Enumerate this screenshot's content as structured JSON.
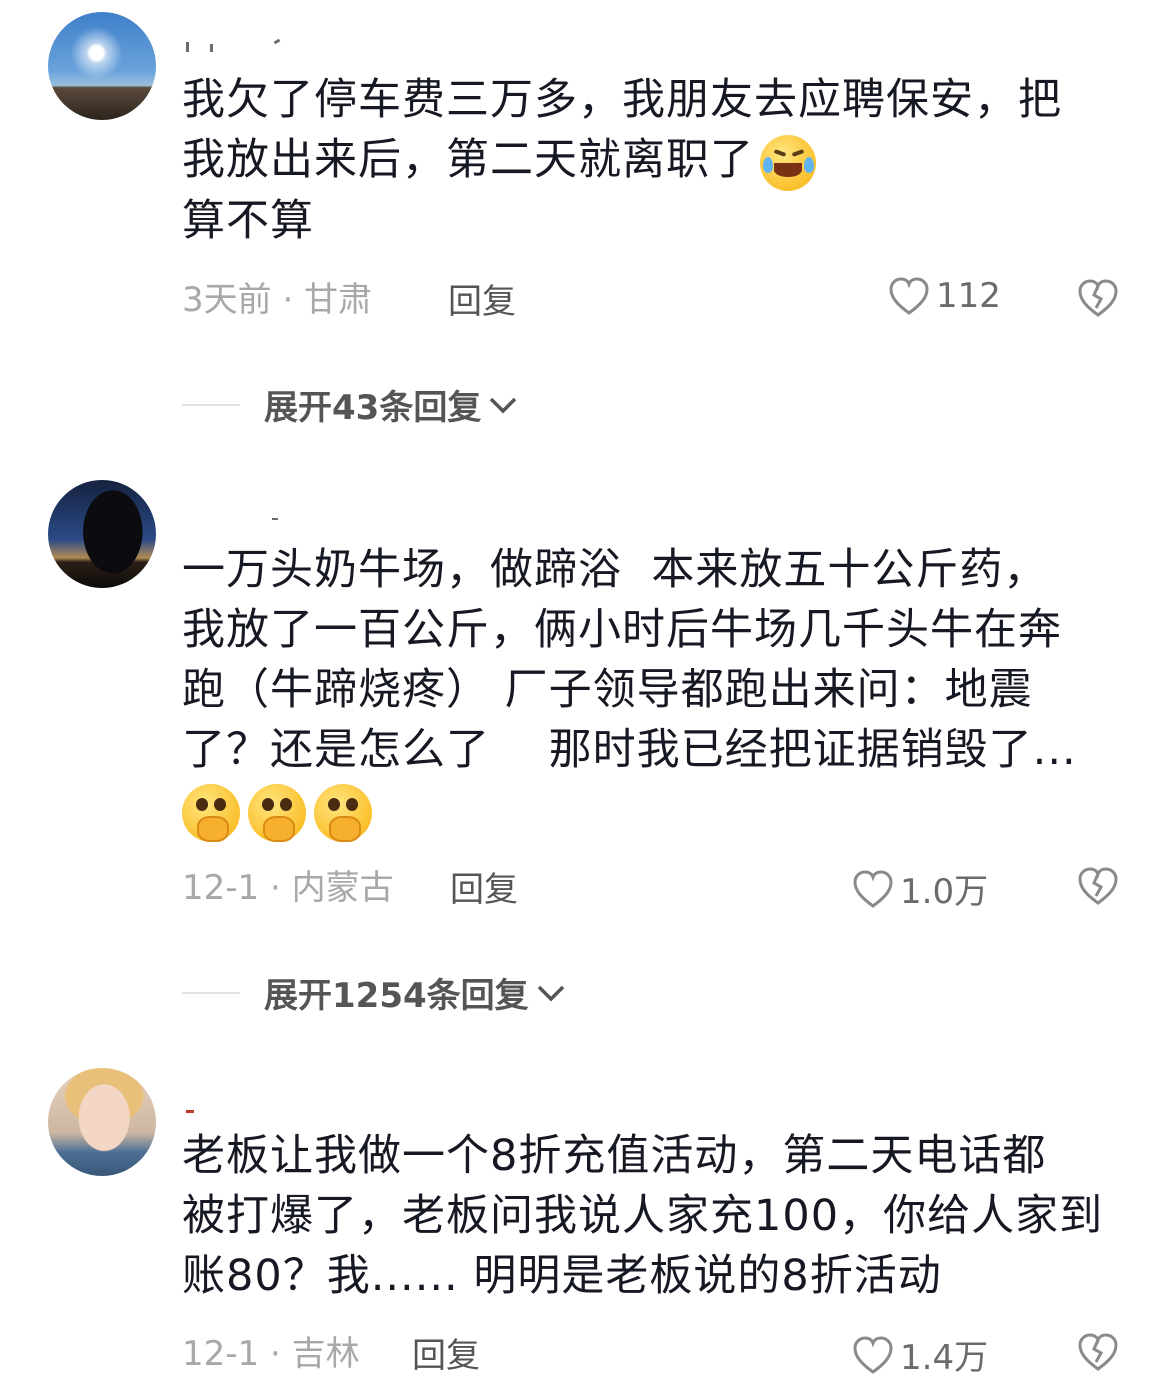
{
  "comments": [
    {
      "text_lines": [
        "我欠了停车费三万多，我朋友去应聘保安，把",
        "我放出来后，第二天就离职了",
        "算不算"
      ],
      "meta": "3天前 · 甘肃",
      "reply_label": "回复",
      "likes": "112",
      "expand_label": "展开43条回复"
    },
    {
      "text_lines": [
        "一万头奶牛场，做蹄浴  本来放五十公斤药，",
        "我放了一百公斤，俩小时后牛场几千头牛在奔",
        "跑（牛蹄烧疼） 厂子领导都跑出来问：地震",
        "了？还是怎么了    那时我已经把证据销毁了..."
      ],
      "meta": "12-1 · 内蒙古",
      "reply_label": "回复",
      "likes": "1.0万",
      "expand_label": "展开1254条回复"
    },
    {
      "text_lines": [
        "老板让我做一个8折充值活动，第二天电话都",
        "被打爆了，老板问我说人家充100，你给人家到",
        "账80？我...... 明明是老板说的8折活动"
      ],
      "meta": "12-1 · 吉林",
      "reply_label": "回复",
      "likes": "1.4万"
    }
  ],
  "icons": {
    "like": "heart-outline-icon",
    "dislike": "broken-heart-icon",
    "expand": "chevron-down-icon",
    "emoji_1": "laughing-crying-emoji",
    "emoji_2": "pleading-face-holding-back-tears-emoji"
  },
  "colors": {
    "text": "#161823",
    "meta": "#a8a8a8",
    "secondary": "#555555"
  }
}
